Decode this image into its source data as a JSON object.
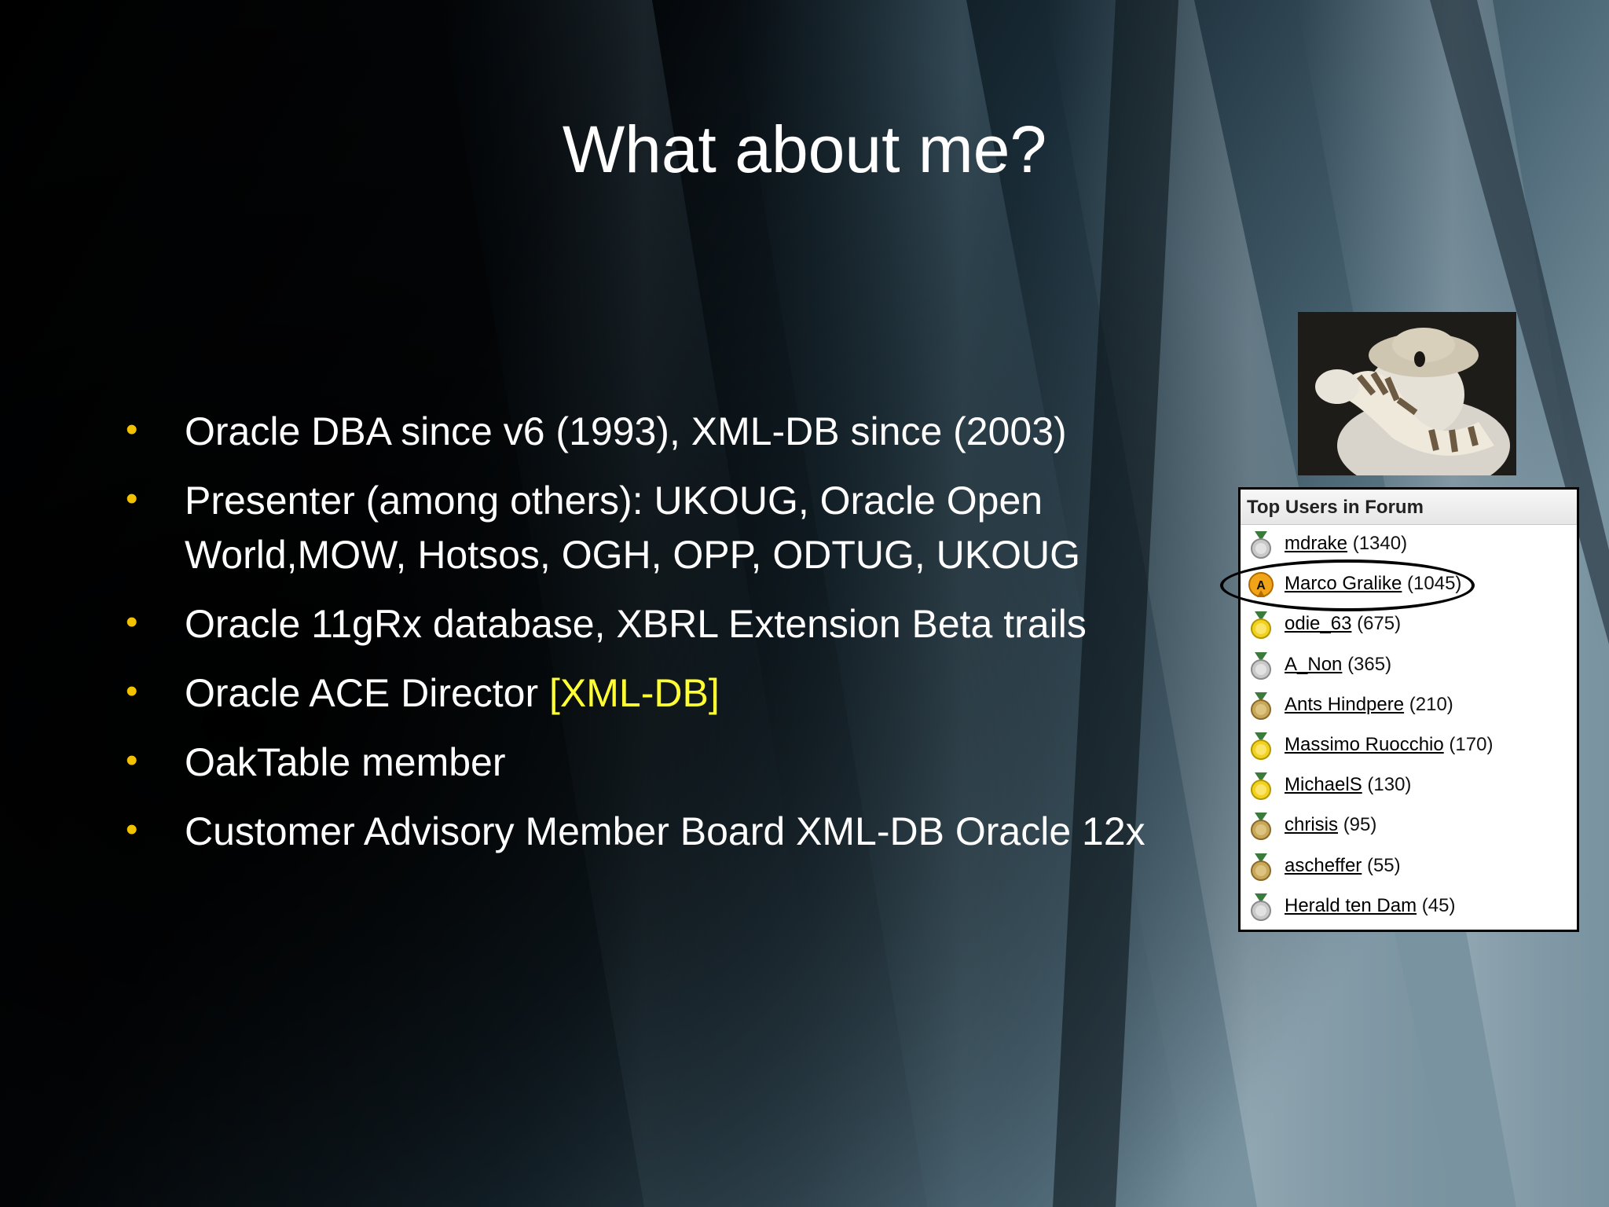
{
  "slide": {
    "title": "What about me?",
    "bullets": [
      {
        "parts": [
          {
            "text": "Oracle DBA since v6 (1993), XML-DB since (2003)",
            "highlight": false
          }
        ]
      },
      {
        "parts": [
          {
            "text": "Presenter (among others): UKOUG, Oracle Open World,MOW, Hotsos, OGH, OPP, ODTUG, UKOUG",
            "highlight": false
          }
        ]
      },
      {
        "parts": [
          {
            "text": "Oracle 11gRx database, XBRL Extension Beta trails",
            "highlight": false
          }
        ]
      },
      {
        "parts": [
          {
            "text": "Oracle ACE Director ",
            "highlight": false
          },
          {
            "text": "[XML-DB]",
            "highlight": true
          }
        ]
      },
      {
        "parts": [
          {
            "text": "OakTable member",
            "highlight": false
          }
        ]
      },
      {
        "parts": [
          {
            "text": "Customer Advisory Member Board XML-DB Oracle 12x",
            "highlight": false
          }
        ]
      }
    ]
  },
  "colors": {
    "title": "#ffffff",
    "text": "#ffffff",
    "bullet": "#f2c200",
    "highlight": "#ffff33"
  },
  "forum_panel": {
    "title": "Top Users in Forum",
    "users": [
      {
        "name": "mdrake",
        "count": "(1340)",
        "medal": "silver-medal-icon"
      },
      {
        "name": "Marco Gralike",
        "count": "(1045)",
        "medal": "ace-icon",
        "circled": true
      },
      {
        "name": "odie_63",
        "count": "(675)",
        "medal": "gold-medal-icon"
      },
      {
        "name": "A_Non",
        "count": "(365)",
        "medal": "silver-medal-icon"
      },
      {
        "name": "Ants Hindpere",
        "count": "(210)",
        "medal": "bronze-medal-icon"
      },
      {
        "name": "Massimo Ruocchio",
        "count": "(170)",
        "medal": "gold-medal-icon"
      },
      {
        "name": "MichaelS",
        "count": "(130)",
        "medal": "gold-medal-icon"
      },
      {
        "name": "chrisis",
        "count": "(95)",
        "medal": "bronze-medal-icon"
      },
      {
        "name": "ascheffer",
        "count": "(55)",
        "medal": "bronze-medal-icon"
      },
      {
        "name": "Herald ten Dam",
        "count": "(45)",
        "medal": "silver-medal-icon"
      }
    ]
  },
  "avatar": {
    "description_icon": "teddy-bear-avatar"
  }
}
